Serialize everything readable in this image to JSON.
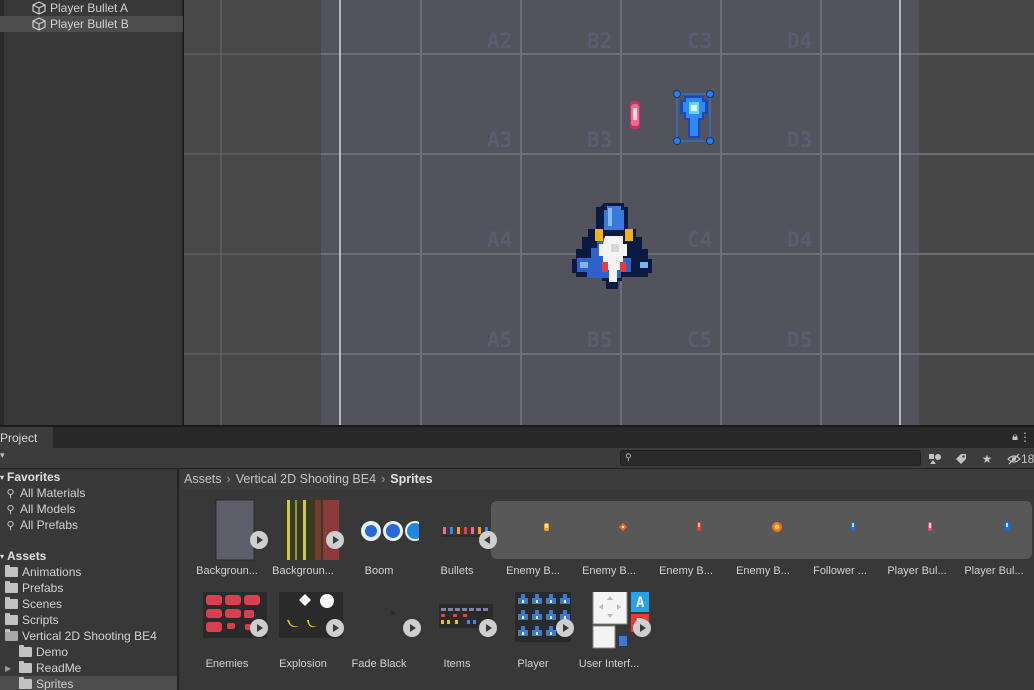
{
  "hierarchy": {
    "items": [
      {
        "label": "Player Bullet A",
        "selected": false
      },
      {
        "label": "Player Bullet B",
        "selected": true
      }
    ]
  },
  "scene": {
    "tile_labels": [
      "A2",
      "B2",
      "C3",
      "D4",
      "A3",
      "B3",
      "D3",
      "A4",
      "C4",
      "D4",
      "A5",
      "B5",
      "C5",
      "D5"
    ]
  },
  "project": {
    "tab_label": "Project",
    "hidden_count": "18",
    "search_placeholder": ""
  },
  "tree": {
    "favorites_header": "Favorites",
    "favorites": [
      "All Materials",
      "All Models",
      "All Prefabs"
    ],
    "assets_header": "Assets",
    "folders": [
      "Animations",
      "Prefabs",
      "Scenes",
      "Scripts",
      "Vertical 2D Shooting BE4"
    ],
    "subfolders": [
      "Demo",
      "ReadMe",
      "Sprites"
    ]
  },
  "breadcrumb": {
    "parts": [
      "Assets",
      "Vertical 2D Shooting BE4",
      "Sprites"
    ]
  },
  "assets": {
    "row1": [
      "Backgroun...",
      "Backgroun...",
      "Boom",
      "Bullets",
      "Enemy B...",
      "Enemy B...",
      "Enemy B...",
      "Enemy B...",
      "Follower ...",
      "Player Bul...",
      "Player Bul..."
    ],
    "row2": [
      "Enemies",
      "Explosion",
      "Fade Black",
      "Items",
      "Player",
      "User Interf..."
    ]
  },
  "colors": {
    "selection": "#4d4d4d",
    "scene_bg": "#484848",
    "tile_bg": "#53535d",
    "expanded_bg": "#585858",
    "gizmo_blue": "#2a7ef0"
  }
}
